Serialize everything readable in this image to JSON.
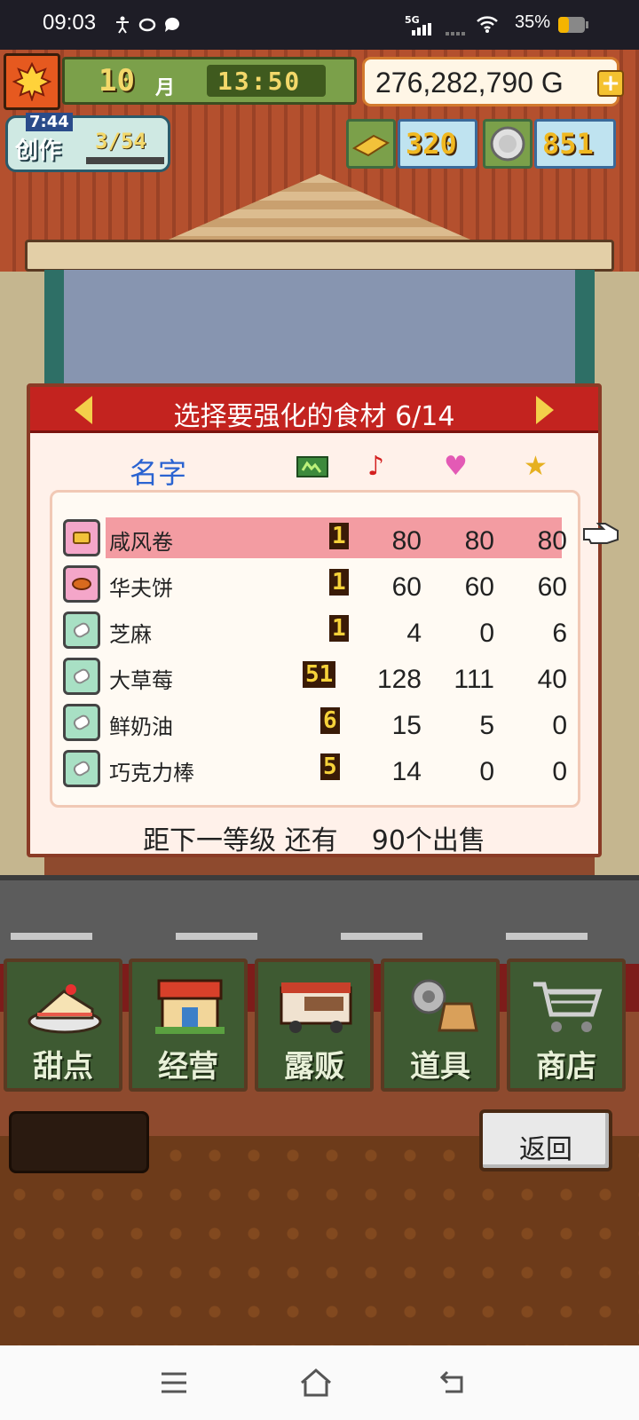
{
  "status_bar": {
    "time": "09:03",
    "battery": "35%",
    "network": "5G"
  },
  "hud": {
    "month": "10",
    "month_label": "月",
    "game_time": "13:50",
    "money": "276,282,790",
    "currency": "G",
    "add_label": "+",
    "create": {
      "label": "创作",
      "timer": "7:44",
      "count": "3/54"
    },
    "gold": "320",
    "medals": "851"
  },
  "dialog": {
    "title": "选择要强化的食材 6/14",
    "column_name": "名字",
    "items": [
      {
        "name": "咸风卷",
        "level": "1",
        "taste": "80",
        "appeal": "80",
        "rating": "80",
        "icon": "snack-icon",
        "selected": true
      },
      {
        "name": "华夫饼",
        "level": "1",
        "taste": "60",
        "appeal": "60",
        "rating": "60",
        "icon": "waffle-icon",
        "selected": false
      },
      {
        "name": "芝麻",
        "level": "1",
        "taste": "4",
        "appeal": "0",
        "rating": "6",
        "icon": "ingredient-icon",
        "selected": false
      },
      {
        "name": "大草莓",
        "level": "51",
        "taste": "128",
        "appeal": "111",
        "rating": "40",
        "icon": "ingredient-icon",
        "selected": false
      },
      {
        "name": "鲜奶油",
        "level": "6",
        "taste": "15",
        "appeal": "5",
        "rating": "0",
        "icon": "ingredient-icon",
        "selected": false
      },
      {
        "name": "巧克力棒",
        "level": "5",
        "taste": "14",
        "appeal": "0",
        "rating": "0",
        "icon": "ingredient-icon",
        "selected": false
      }
    ],
    "footer": "距下一等级 还有    90个出售"
  },
  "bottom_nav": [
    {
      "label": "甜点",
      "icon": "cake-icon"
    },
    {
      "label": "经营",
      "icon": "shop-icon"
    },
    {
      "label": "露贩",
      "icon": "food-truck-icon"
    },
    {
      "label": "道具",
      "icon": "gear-bag-icon"
    },
    {
      "label": "商店",
      "icon": "cart-icon"
    }
  ],
  "back_label": "返回",
  "colors": {
    "dialog_header": "#c3231f",
    "selected_row": "#f39ca2",
    "nav_bg": "#3e5a32"
  }
}
